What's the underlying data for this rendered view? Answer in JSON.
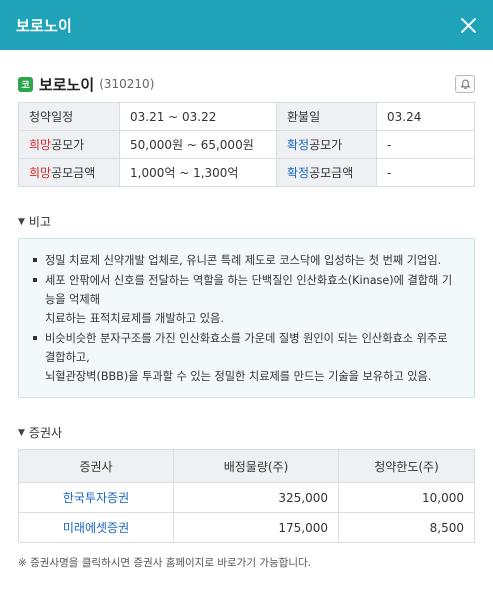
{
  "header": {
    "title": "보로노이"
  },
  "company": {
    "badge": "코",
    "name": "보로노이",
    "code": "(310210)"
  },
  "info": {
    "subscription_date_label": "청약일정",
    "subscription_date_value": "03.21 ~ 03.22",
    "refund_date_label": "환불일",
    "refund_date_value": "03.24",
    "desired_price_label_highlight": "희망",
    "desired_price_label_rest": "공모가",
    "desired_price_value": "50,000원 ~ 65,000원",
    "confirmed_price_label_highlight": "확정",
    "confirmed_price_label_rest": "공모가",
    "confirmed_price_value": "-",
    "desired_amount_label_highlight": "희망",
    "desired_amount_label_rest": "공모금액",
    "desired_amount_value": "1,000억 ~ 1,300억",
    "confirmed_amount_label_highlight": "확정",
    "confirmed_amount_label_rest": "공모금액",
    "confirmed_amount_value": "-"
  },
  "notes": {
    "title": "비고",
    "items": [
      [
        "정밀 치료제 신약개발 업체로, 유니콘 특례 제도로 코스닥에 입성하는 첫 번째 기업임."
      ],
      [
        "세포 안팎에서 신호를 전달하는 역할을 하는 단백질인 인산화효소(Kinase)에 결합해 기능을 억제해",
        "치료하는 표적치료제를 개발하고 있음."
      ],
      [
        "비슷비슷한 분자구조를 가진 인산화효소를 가운데 질병 원인이 되는 인산화효소 위주로 결합하고,",
        "뇌혈관장벽(BBB)을 투과할 수 있는 정밀한 치료제를 만드는 기술을 보유하고 있음."
      ]
    ]
  },
  "brokers": {
    "title": "증권사",
    "columns": [
      "증권사",
      "배정물량(주)",
      "청약한도(주)"
    ],
    "rows": [
      {
        "name": "한국투자증권",
        "allocation": "325,000",
        "limit": "10,000"
      },
      {
        "name": "미래에셋증권",
        "allocation": "175,000",
        "limit": "8,500"
      }
    ]
  },
  "footnote": "※ 증권사명을 클릭하시면 증권사 홈페이지로 바로가기 가능합니다.",
  "icons": {
    "close": "close-icon",
    "bell": "bell-icon",
    "badge": "kosdaq-badge"
  },
  "colors": {
    "header_bg": "#1fa3b8",
    "highlight_red": "#d9242a",
    "highlight_blue": "#1565c0",
    "badge_green": "#2da54a"
  }
}
